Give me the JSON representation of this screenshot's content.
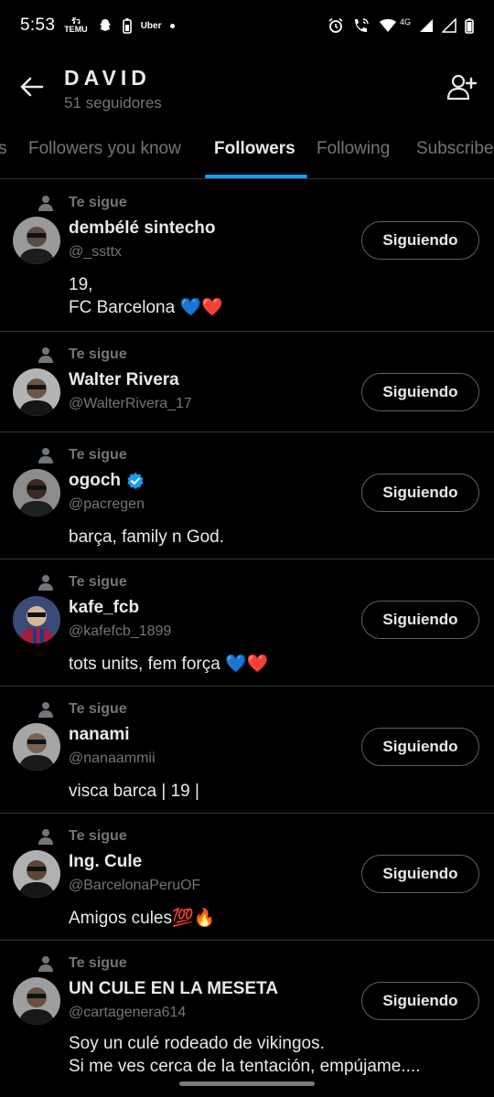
{
  "status_bar": {
    "time": "5:53",
    "temu_label_top": "รัว",
    "temu_label_bottom": "TEMU",
    "uber_label": "Uber",
    "network": "4G"
  },
  "header": {
    "name": "DAVID",
    "followers_count": "51 seguidores"
  },
  "tabs": [
    {
      "label": "s"
    },
    {
      "label": "Followers you know"
    },
    {
      "label": "Followers"
    },
    {
      "label": "Following"
    },
    {
      "label": "Subscribe"
    }
  ],
  "follows_you_label": "Te sigue",
  "follow_button_label": "Siguiendo",
  "followers": [
    {
      "name": "dembélé sintecho",
      "handle": "@_ssttx",
      "bio": "19,\nFC Barcelona 💙❤️",
      "verified": false
    },
    {
      "name": "Walter Rivera",
      "handle": "@WalterRivera_17",
      "bio": "",
      "verified": false
    },
    {
      "name": "ogoch",
      "handle": "@pacregen",
      "bio": "barça, family n God.",
      "verified": true
    },
    {
      "name": "kafe_fcb",
      "handle": "@kafefcb_1899",
      "bio": "tots units, fem força 💙❤️",
      "verified": false
    },
    {
      "name": "nanami",
      "handle": "@nanaammii",
      "bio": "visca barca | 19 |",
      "verified": false
    },
    {
      "name": "Ing. Cule",
      "handle": "@BarcelonaPeruOF",
      "bio": "Amigos cules💯🔥",
      "verified": false
    },
    {
      "name": "UN CULE EN LA MESETA",
      "handle": "@cartagenera614",
      "bio": "Soy un culé rodeado de vikingos.\nSi me ves cerca de la tentación, empújame....",
      "verified": false
    }
  ],
  "colors": {
    "accent": "#1d9bf0",
    "background": "#000000",
    "secondary_text": "#71767b",
    "divider": "#2f3336"
  }
}
